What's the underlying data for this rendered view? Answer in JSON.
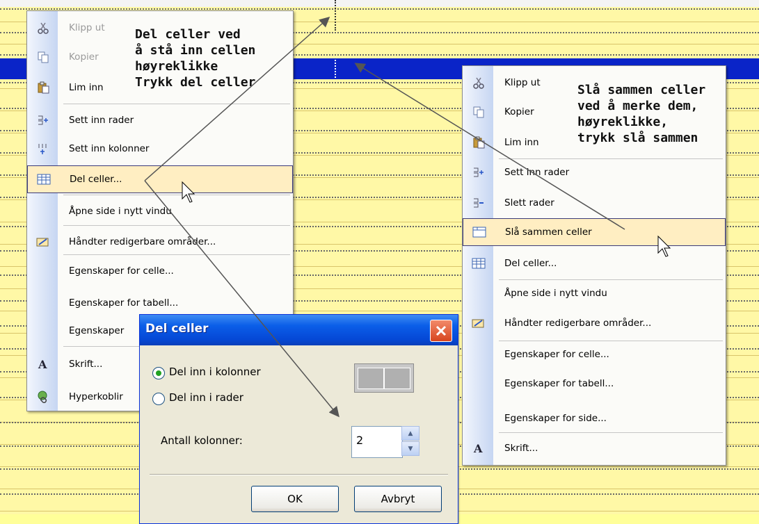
{
  "left_menu": {
    "items": [
      {
        "label": "Klipp ut",
        "icon": "scissors-icon",
        "disabled": true
      },
      {
        "label": "Kopier",
        "icon": "copy-icon",
        "disabled": true
      },
      {
        "label": "Lim inn",
        "icon": "paste-icon",
        "disabled": false
      },
      {
        "label": "Sett inn rader",
        "icon": "insert-rows-icon",
        "disabled": false
      },
      {
        "label": "Sett inn kolonner",
        "icon": "insert-columns-icon",
        "disabled": false
      },
      {
        "label": "Del celler...",
        "icon": "split-cells-icon",
        "disabled": false,
        "highlighted": true
      },
      {
        "label": "Åpne side i nytt vindu",
        "icon": "",
        "disabled": false
      },
      {
        "label": "Håndter redigerbare områder...",
        "icon": "editable-regions-icon",
        "disabled": false
      },
      {
        "label": "Egenskaper for celle...",
        "icon": "",
        "disabled": false
      },
      {
        "label": "Egenskaper for tabell...",
        "icon": "",
        "disabled": false
      },
      {
        "label": "Egenskaper",
        "icon": "",
        "disabled": false
      },
      {
        "label": "Skrift...",
        "icon": "font-icon",
        "disabled": false
      },
      {
        "label": "Hyperkoblir",
        "icon": "hyperlink-icon",
        "disabled": false
      }
    ]
  },
  "right_menu": {
    "items": [
      {
        "label": "Klipp ut",
        "icon": "scissors-icon",
        "disabled": false
      },
      {
        "label": "Kopier",
        "icon": "copy-icon",
        "disabled": false
      },
      {
        "label": "Lim inn",
        "icon": "paste-icon",
        "disabled": false
      },
      {
        "label": "Sett inn rader",
        "icon": "insert-rows-icon",
        "disabled": false
      },
      {
        "label": "Slett rader",
        "icon": "delete-rows-icon",
        "disabled": false
      },
      {
        "label": "Slå sammen celler",
        "icon": "merge-cells-icon",
        "disabled": false,
        "highlighted": true
      },
      {
        "label": "Del celler...",
        "icon": "split-cells-icon",
        "disabled": false
      },
      {
        "label": "Åpne side i nytt vindu",
        "icon": "",
        "disabled": false
      },
      {
        "label": "Håndter redigerbare områder...",
        "icon": "editable-regions-icon",
        "disabled": false
      },
      {
        "label": "Egenskaper for celle...",
        "icon": "",
        "disabled": false
      },
      {
        "label": "Egenskaper for tabell...",
        "icon": "",
        "disabled": false
      },
      {
        "label": "Egenskaper for side...",
        "icon": "",
        "disabled": false
      },
      {
        "label": "Skrift...",
        "icon": "font-icon",
        "disabled": false
      }
    ]
  },
  "notes": {
    "split": "Del celler ved\nå stå inn cellen\nhøyreklikke\nTrykk del celler",
    "merge": "Slå sammen celler\nved å merke dem,\nhøyreklikke,\ntrykk slå sammen"
  },
  "dialog": {
    "title": "Del celler",
    "option_columns": "Del inn i kolonner",
    "option_rows": "Del inn i rader",
    "selected_option": "Del inn i kolonner",
    "count_label": "Antall kolonner:",
    "count_value": "2",
    "ok_label": "OK",
    "cancel_label": "Avbryt"
  },
  "colors": {
    "table_background": "#fff8a6",
    "selected_row": "#0a24c8",
    "menu_highlight": "#ffeec2",
    "dialog_titlebar": "#0b5ee8",
    "close_button": "#d7451e"
  }
}
